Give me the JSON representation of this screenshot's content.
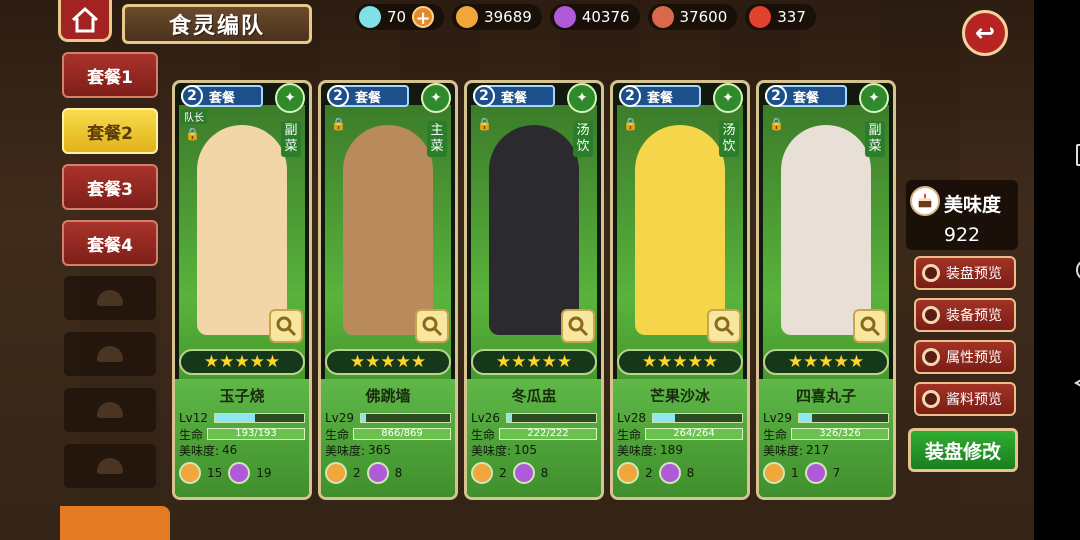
{
  "header": {
    "title": "食灵编队",
    "resources": [
      {
        "icon": "diamond-icon",
        "value": "70",
        "color": "#7fe0e8"
      },
      {
        "icon": "potion-icon",
        "value": "39689",
        "color": "#f1a63a"
      },
      {
        "icon": "crystal-icon",
        "value": "40376",
        "color": "#b05ad9"
      },
      {
        "icon": "meat-icon",
        "value": "37600",
        "color": "#d9694a"
      },
      {
        "icon": "dish-icon",
        "value": "337",
        "color": "#e2422c"
      }
    ]
  },
  "sets": [
    "套餐1",
    "套餐2",
    "套餐3",
    "套餐4"
  ],
  "active_set": "套餐2",
  "cards": [
    {
      "set_num": "2",
      "set_label": "套餐",
      "type": "副菜",
      "type_icon": "fork-icon",
      "leader": "队长",
      "name": "玉子烧",
      "level": "Lv12",
      "level_fill": 0.45,
      "hp_label": "生命",
      "hp": "193/193",
      "taste_label": "美味度:",
      "taste": "46",
      "mat1": "15",
      "mat2": "19",
      "stars": "★★★★★",
      "color": "#f3d6a8"
    },
    {
      "set_num": "2",
      "set_label": "套餐",
      "type": "主菜",
      "type_icon": "knife-icon",
      "leader": "",
      "name": "佛跳墙",
      "level": "Lv29",
      "level_fill": 0.05,
      "hp_label": "生命",
      "hp": "866/869",
      "taste_label": "美味度:",
      "taste": "365",
      "mat1": "2",
      "mat2": "8",
      "stars": "★★★★★",
      "color": "#b98a5c"
    },
    {
      "set_num": "2",
      "set_label": "套餐",
      "type": "汤饮",
      "type_icon": "soup-icon",
      "leader": "",
      "name": "冬瓜盅",
      "level": "Lv26",
      "level_fill": 0.05,
      "hp_label": "生命",
      "hp": "222/222",
      "taste_label": "美味度:",
      "taste": "105",
      "mat1": "2",
      "mat2": "8",
      "stars": "★★★★★",
      "color": "#2b2a2e"
    },
    {
      "set_num": "2",
      "set_label": "套餐",
      "type": "汤饮",
      "type_icon": "soup-icon",
      "leader": "",
      "name": "芒果沙冰",
      "level": "Lv28",
      "level_fill": 0.25,
      "hp_label": "生命",
      "hp": "264/264",
      "taste_label": "美味度:",
      "taste": "189",
      "mat1": "2",
      "mat2": "8",
      "stars": "★★★★★",
      "color": "#f5d64a"
    },
    {
      "set_num": "2",
      "set_label": "套餐",
      "type": "副菜",
      "type_icon": "fork-icon",
      "leader": "",
      "name": "四喜丸子",
      "level": "Lv29",
      "level_fill": 0.15,
      "hp_label": "生命",
      "hp": "326/326",
      "taste_label": "美味度:",
      "taste": "217",
      "mat1": "1",
      "mat2": "7",
      "stars": "★★★★★",
      "color": "#e8e0d6"
    }
  ],
  "sidebar": {
    "taste_label": "美味度",
    "taste_value": "922",
    "buttons": [
      "装盘预览",
      "装备预览",
      "属性预览",
      "酱料预览"
    ],
    "modify": "装盘修改"
  }
}
